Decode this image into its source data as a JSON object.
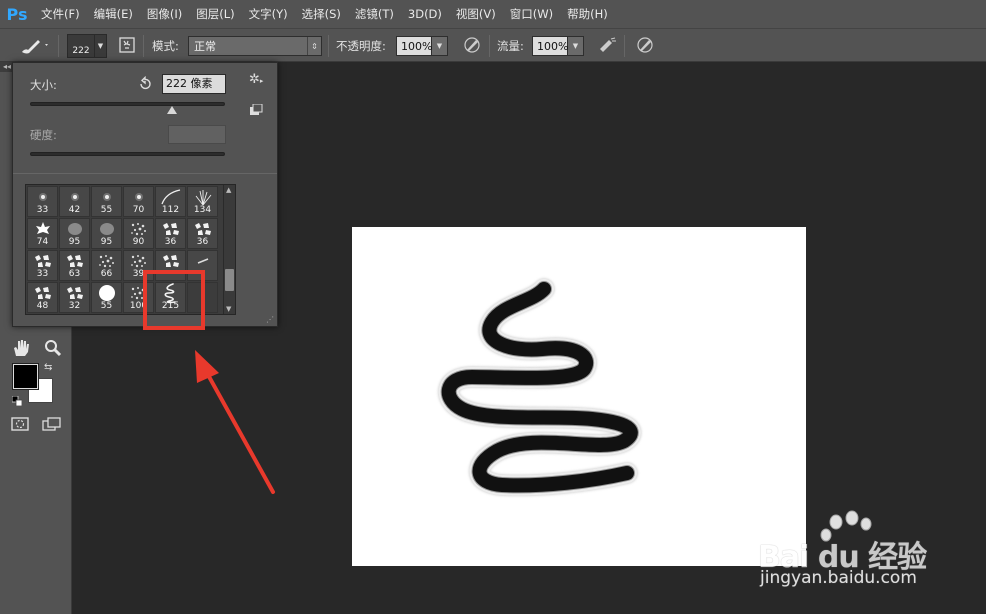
{
  "app": {
    "logo": "Ps"
  },
  "menu": [
    "文件(F)",
    "编辑(E)",
    "图像(I)",
    "图层(L)",
    "文字(Y)",
    "选择(S)",
    "滤镜(T)",
    "3D(D)",
    "视图(V)",
    "窗口(W)",
    "帮助(H)"
  ],
  "options_bar": {
    "brush_size": "222",
    "mode_label": "模式:",
    "mode_value": "正常",
    "opacity_label": "不透明度:",
    "opacity_value": "100%",
    "flow_label": "流量:",
    "flow_value": "100%"
  },
  "brush_panel": {
    "size_label": "大小:",
    "size_value": "222 像素",
    "size_fraction": 0.73,
    "hardness_label": "硬度:",
    "hardness_value": "",
    "presets": [
      {
        "size": "33",
        "icon": "dot-soft"
      },
      {
        "size": "42",
        "icon": "dot-soft"
      },
      {
        "size": "55",
        "icon": "dot-soft"
      },
      {
        "size": "70",
        "icon": "dot-soft"
      },
      {
        "size": "112",
        "icon": "stroke-curve"
      },
      {
        "size": "134",
        "icon": "grass"
      },
      {
        "size": "74",
        "icon": "maple-leaf"
      },
      {
        "size": "95",
        "icon": "leaf"
      },
      {
        "size": "95",
        "icon": "leaf"
      },
      {
        "size": "90",
        "icon": "texture"
      },
      {
        "size": "36",
        "icon": "scatter"
      },
      {
        "size": "36",
        "icon": "scatter"
      },
      {
        "size": "33",
        "icon": "scatter"
      },
      {
        "size": "63",
        "icon": "scatter"
      },
      {
        "size": "66",
        "icon": "texture"
      },
      {
        "size": "39",
        "icon": "texture"
      },
      {
        "size": "",
        "icon": "scatter"
      },
      {
        "size": "",
        "icon": "dash"
      },
      {
        "size": "48",
        "icon": "scatter"
      },
      {
        "size": "32",
        "icon": "scatter"
      },
      {
        "size": "55",
        "icon": "dot-hard"
      },
      {
        "size": "100",
        "icon": "texture"
      },
      {
        "size": "215",
        "icon": "squiggle"
      },
      {
        "size": "",
        "icon": "empty"
      }
    ]
  },
  "colors": {
    "foreground": "#000000",
    "background": "#ffffff",
    "accent_red": "#e8392c",
    "ps_blue": "#31a8ff"
  },
  "watermark": {
    "logo_text": "Bai du 经验",
    "url": "jingyan.baidu.com"
  }
}
